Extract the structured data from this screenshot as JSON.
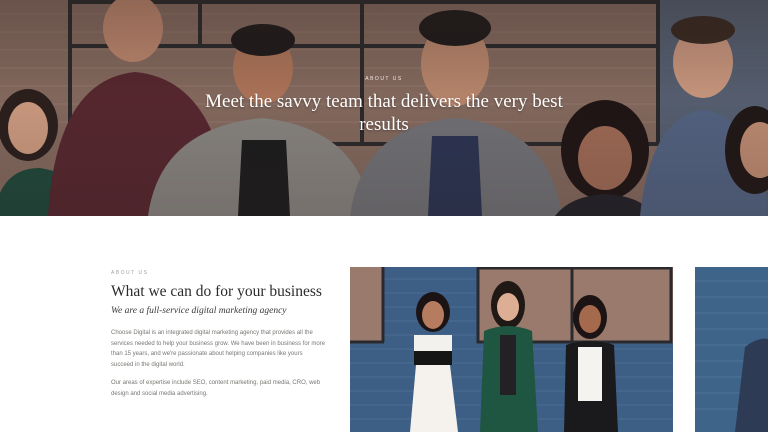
{
  "hero": {
    "kicker": "ABOUT US",
    "title": "Meet the savvy team that delivers the very best results"
  },
  "about": {
    "kicker": "ABOUT US",
    "heading": "What we can do for your business",
    "subheading": "We are a full-service digital marketing agency",
    "paragraph1": "Choose Digital is an integrated digital marketing agency that provides all the services needed to help your business grow. We have been in business for more than 15 years, and we're passionate about helping companies like yours succeed in the digital world.",
    "paragraph2": "Our areas of expertise include SEO, content marketing, paid media, CRO, web design and social media advertising."
  },
  "colors": {
    "brick_wall": "#8a6d62",
    "blue_wall": "#3d5f86",
    "text_dark": "#2b2b2b",
    "text_muted": "#7a7773"
  }
}
